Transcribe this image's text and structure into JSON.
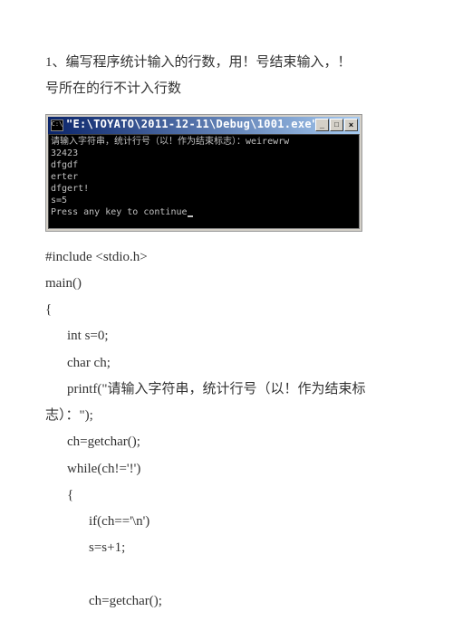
{
  "problem": {
    "title_line1": "1、编写程序统计输入的行数，用！号结束输入，！",
    "title_line2": "号所在的行不计入行数"
  },
  "console": {
    "title": "\"E:\\TOYATO\\2011-12-11\\Debug\\1001.exe\"",
    "icon_text": "C:\\",
    "min_btn": "_",
    "max_btn": "□",
    "close_btn": "×",
    "lines": [
      "请输入字符串，统计行号（以！作为结束标志）：weirewrw",
      "32423",
      "dfgdf",
      "erter",
      "dfgert!",
      "s=5",
      "Press any key to continue"
    ]
  },
  "code": {
    "l1": "#include <stdio.h>",
    "l2": "main()",
    "l3": "{",
    "l4": "int s=0;",
    "l5": "char ch;",
    "l6": "printf(\"请输入字符串，统计行号（以！作为结束标",
    "l7": "志）：\");",
    "l8": "ch=getchar();",
    "l9": "while(ch!='!')",
    "l10": "{",
    "l11": "if(ch=='\\n')",
    "l12": "s=s+1;",
    "l13": "ch=getchar();"
  }
}
